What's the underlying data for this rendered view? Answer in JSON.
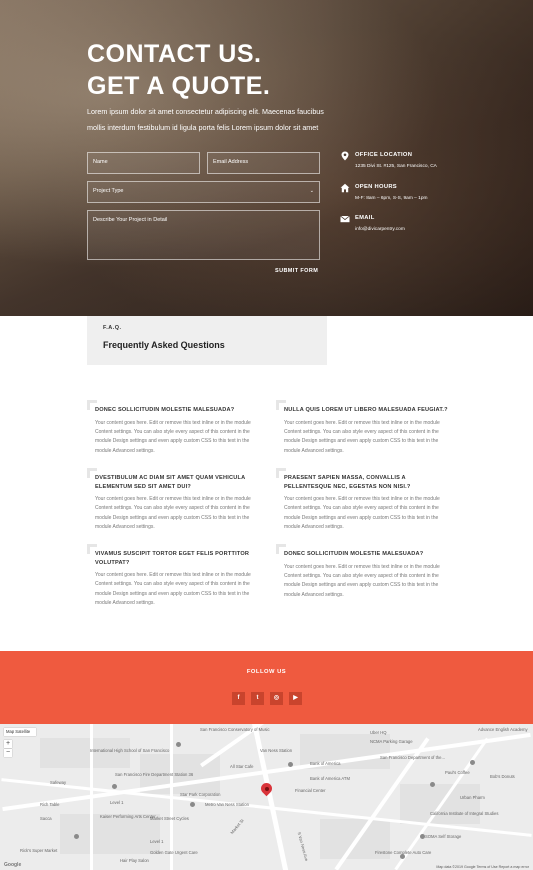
{
  "hero": {
    "title_line1": "CONTACT US.",
    "title_line2": "GET A QUOTE.",
    "subtitle": "Lorem ipsum dolor sit amet consectetur adipiscing elit. Maecenas faucibus mollis interdum festibulum id ligula porta felis Lorem ipsum dolor sit amet"
  },
  "form": {
    "name_placeholder": "Name",
    "email_placeholder": "Email Address",
    "project_type_placeholder": "Project Type",
    "details_placeholder": "Describe Your Project in Detail",
    "submit_label": "SUBMIT FORM"
  },
  "contact_info": {
    "office": {
      "title": "OFFICE LOCATION",
      "text": "1235 Divi St. #125, San Francisco, CA",
      "icon": "map-pin-icon"
    },
    "hours": {
      "title": "OPEN HOURS",
      "text": "M-F: 8am – 6pm, S-S, 9am – 1pm",
      "icon": "home-icon"
    },
    "email": {
      "title": "EMAIL",
      "text": "info@divicarpentry.com",
      "icon": "envelope-icon"
    }
  },
  "faq": {
    "kicker": "F.A.Q.",
    "title": "Frequently Asked Questions",
    "items": [
      {
        "question": "DONEC SOLLICITUDIN MOLESTIE MALESUADA?",
        "answer": "Your content goes here. Edit or remove this text inline or in the module Content settings. You can also style every aspect of this content in the module Design settings and even apply custom CSS to this text in the module Advanced settings."
      },
      {
        "question": "NULLA QUIS LOREM UT LIBERO MALESUADA FEUGIAT.?",
        "answer": "Your content goes here. Edit or remove this text inline or in the module Content settings. You can also style every aspect of this content in the module Design settings and even apply custom CSS to this text in the module Advanced settings."
      },
      {
        "question": "DVESTIBULUM AC DIAM SIT AMET QUAM VEHICULA ELEMENTUM SED SIT AMET DUI?",
        "answer": "Your content goes here. Edit or remove this text inline or in the module Content settings. You can also style every aspect of this content in the module Design settings and even apply custom CSS to this text in the module Advanced settings."
      },
      {
        "question": "PRAESENT SAPIEN MASSA, CONVALLIS A PELLENTESQUE NEC, EGESTAS NON NISI.?",
        "answer": "Your content goes here. Edit or remove this text inline or in the module Content settings. You can also style every aspect of this content in the module Design settings and even apply custom CSS to this text in the module Advanced settings."
      },
      {
        "question": "VIVAMUS SUSCIPIT TORTOR EGET FELIS PORTTITOR VOLUTPAT?",
        "answer": "Your content goes here. Edit or remove this text inline or in the module Content settings. You can also style every aspect of this content in the module Design settings and even apply custom CSS to this text in the module Advanced settings."
      },
      {
        "question": "DONEC SOLLICITUDIN MOLESTIE MALESUADA?",
        "answer": "Your content goes here. Edit or remove this text inline or in the module Content settings. You can also style every aspect of this content in the module Design settings and even apply custom CSS to this text in the module Advanced settings."
      }
    ]
  },
  "follow": {
    "title": "FOLLOW US",
    "accent_color": "#ef5a3f",
    "socials": [
      {
        "label": "f",
        "icon": "facebook-icon"
      },
      {
        "label": "t",
        "icon": "twitter-icon"
      },
      {
        "label": "◎",
        "icon": "instagram-icon"
      },
      {
        "label": "▶",
        "icon": "youtube-icon"
      }
    ]
  },
  "map": {
    "type_control": "Map   Satellite",
    "zoom_in": "+",
    "zoom_out": "−",
    "google": "Google",
    "footer": "Map data ©2019 Google   Terms of Use   Report a map error",
    "labels": {
      "conservatory": "San Francisco Conservatory of Music",
      "uber": "Uber HQ",
      "nasa": "NCMA Parking Garage",
      "sf_dept": "San Francisco Department of the...",
      "intl_high": "International High School of San Francisco",
      "van_ness": "Van Ness Station",
      "bank": "Bank of America",
      "fire": "San Francisco Fire Department Station 36",
      "safeway": "Safeway",
      "all_star": "All Star Cafe",
      "boa_atm": "Bank of America ATM",
      "pauls": "Paul's Coffee",
      "bob": "Bob's Donuts",
      "financial": "Financial Center",
      "star_park": "Star Park Corporation",
      "urban_pharm": "Urban Pharm",
      "ciis": "California Institute of Integral Studies",
      "metro": "Metro Van Ness Station",
      "rich_table": "Rich Table",
      "kaiser": "Kaiser Performing Arts Center",
      "market_cycles": "Market Street Cycles",
      "sacca": "Sacca",
      "rickys": "Rick's Super Market",
      "golden_gate": "Golden Gate Urgent Care",
      "hair_play": "Hair Play Salon",
      "self_storage": "SOMA Self Storage",
      "firestone": "Firestone Complete Auto Care",
      "advance": "Advance English Academy",
      "street": "S Van Ness Ave",
      "market_st": "Market St",
      "level1": "Level 1",
      "level1b": "Level 1"
    }
  }
}
